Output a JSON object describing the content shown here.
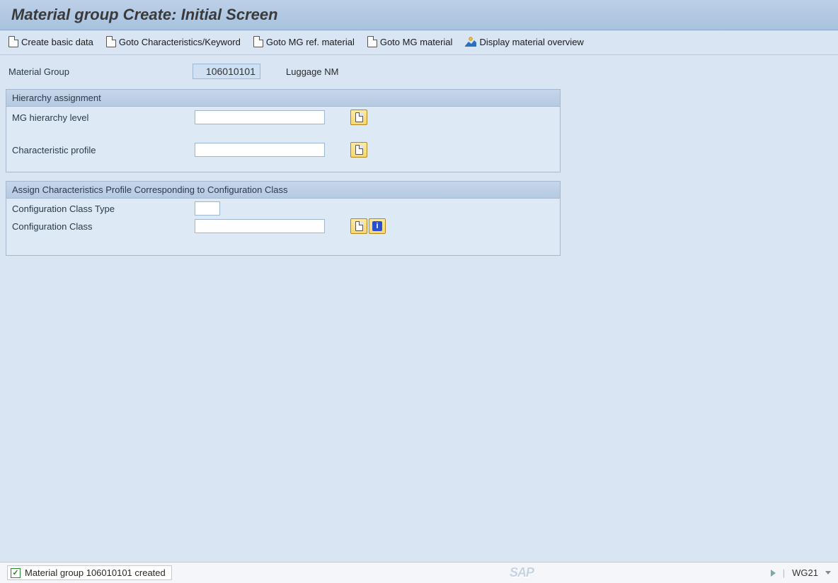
{
  "title": "Material group  Create: Initial Screen",
  "toolbar": {
    "create_basic_data": "Create basic data",
    "goto_characteristics": "Goto Characteristics/Keyword",
    "goto_mg_ref_material": "Goto MG ref. material",
    "goto_mg_material": "Goto MG material",
    "display_material_overview": "Display material overview"
  },
  "main": {
    "material_group_label": "Material Group",
    "material_group_value": "106010101",
    "material_group_desc": "Luggage NM"
  },
  "group1": {
    "header": "Hierarchy assignment",
    "mg_hierarchy_level_label": "MG hierarchy level",
    "mg_hierarchy_level_value": "",
    "characteristic_profile_label": "Characteristic profile",
    "characteristic_profile_value": ""
  },
  "group2": {
    "header": "Assign Characteristics Profile Corresponding to Configuration Class",
    "config_class_type_label": "Configuration Class Type",
    "config_class_type_value": "",
    "config_class_label": "Configuration Class",
    "config_class_value": ""
  },
  "status": {
    "message": "Material group 106010101 created",
    "system_id": "WG21",
    "logo": "SAP"
  }
}
